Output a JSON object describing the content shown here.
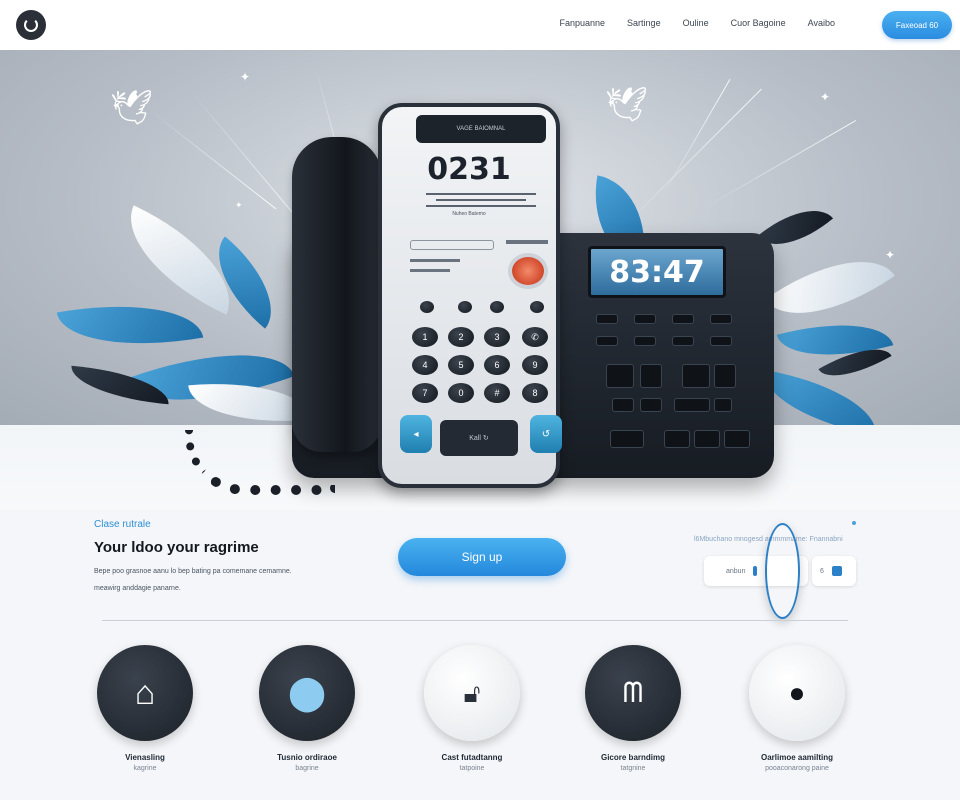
{
  "header": {
    "nav": [
      "Fanpuanne",
      "Sartinge",
      "Ouline",
      "Cuor Bagoine",
      "Avaibo"
    ],
    "cta": "Faxeoad 60"
  },
  "hero": {
    "phone_number": "0231",
    "clock": "83:47",
    "speaker_label": "VAGE BAIOMNAL",
    "screen_sub": "Nuheo Batemo",
    "center_key": "Kall ↻"
  },
  "intro": {
    "eyebrow": "Clase rutrale",
    "headline": "Your ldoo your ragrime",
    "description": "Bepe poo grasnoe aanu lo bep bating pa comemane cemamne.\nmeawirg anddagie panarne.",
    "signup": "Sign up",
    "right_title": "l6Mbuchano mnogesd ammmmame: Fnannabni",
    "pill_left": "anbun",
    "pill_right": "6"
  },
  "features": [
    {
      "title": "Vienasling",
      "subtitle": "kagrine",
      "icon": "house-tie-icon",
      "style": "dark"
    },
    {
      "title": "Tusnio ordiraoe",
      "subtitle": "bagrine",
      "icon": "location-pin-icon",
      "style": "dark"
    },
    {
      "title": "Cast futadtanng",
      "subtitle": "tatpoine",
      "icon": "lock-icon",
      "style": "light"
    },
    {
      "title": "Gicore barndimg",
      "subtitle": "tatgnine",
      "icon": "users-icon",
      "style": "dark"
    },
    {
      "title": "Oarlimoe aamilting",
      "subtitle": "pooaconarong paine",
      "icon": "padlock-icon",
      "style": "light"
    }
  ],
  "colors": {
    "accent": "#2a8ce0",
    "hero_bg": "#b6bdc6",
    "dark": "#1c2128"
  }
}
